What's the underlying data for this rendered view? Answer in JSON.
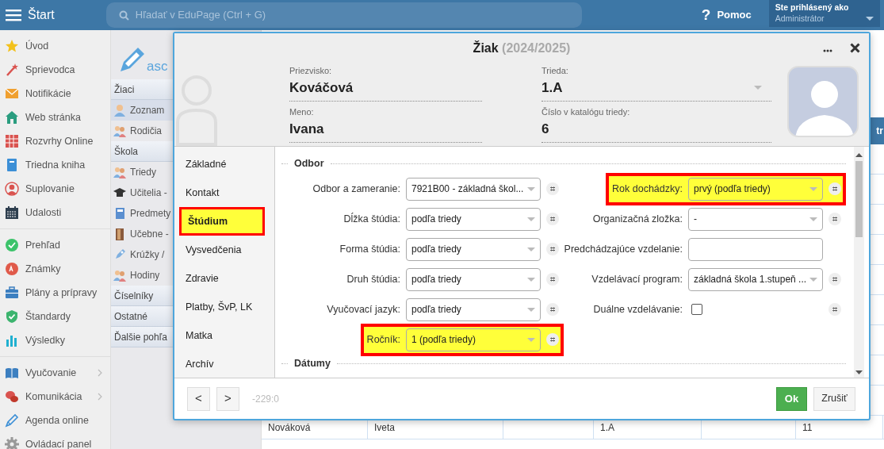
{
  "topbar": {
    "menu_label": "Štart",
    "search_placeholder": "Hľadať v EduPage (Ctrl + G)",
    "help_icon": "?",
    "help_label": "Pomoc",
    "login_caption": "Ste prihlásený ako",
    "user": "Administrátor"
  },
  "sidebar": {
    "groups": [
      {
        "items": [
          {
            "label": "Úvod",
            "has_submenu": false
          },
          {
            "label": "Sprievodca",
            "has_submenu": false
          },
          {
            "label": "Notifikácie",
            "has_submenu": false
          },
          {
            "label": "Web stránka",
            "has_submenu": false
          },
          {
            "label": "Rozvrhy Online",
            "has_submenu": false
          },
          {
            "label": "Triedna kniha",
            "has_submenu": false
          },
          {
            "label": "Suplovanie",
            "has_submenu": false
          },
          {
            "label": "Udalosti",
            "has_submenu": false
          }
        ]
      },
      {
        "items": [
          {
            "label": "Prehľad",
            "has_submenu": false
          },
          {
            "label": "Známky",
            "has_submenu": false
          },
          {
            "label": "Plány a prípravy",
            "has_submenu": false
          },
          {
            "label": "Štandardy",
            "has_submenu": false
          },
          {
            "label": "Výsledky",
            "has_submenu": false
          }
        ]
      },
      {
        "items": [
          {
            "label": "Vyučovanie",
            "has_submenu": true
          },
          {
            "label": "Komunikácia",
            "has_submenu": true
          },
          {
            "label": "Agenda online",
            "has_submenu": false
          },
          {
            "label": "Ovládací panel",
            "has_submenu": false
          }
        ]
      }
    ]
  },
  "subnav": {
    "logo_text": "asc",
    "sections": [
      {
        "title": "Žiaci",
        "items": [
          {
            "label": "Zoznam",
            "selected": true
          },
          {
            "label": "Rodičia",
            "selected": false
          }
        ]
      },
      {
        "title": "Škola",
        "items": [
          {
            "label": "Triedy",
            "selected": false
          },
          {
            "label": "Učitelia -",
            "selected": false
          },
          {
            "label": "Predmety",
            "selected": false
          },
          {
            "label": "Učebne -",
            "selected": false
          },
          {
            "label": "Krúžky /",
            "selected": false
          },
          {
            "label": "Hodiny",
            "selected": false
          }
        ]
      },
      {
        "title": "Číselníky"
      },
      {
        "title": "Ostatné"
      },
      {
        "title": "Ďalšie pohľa"
      }
    ]
  },
  "background_table": {
    "header_fragment": "tr",
    "rows": [
      {
        "cells": [
          "Nováková",
          "Iveta",
          "",
          "1.A",
          "",
          "11"
        ]
      }
    ]
  },
  "dialog": {
    "title": "Žiak",
    "subtitle": "(2024/2025)",
    "header_fields": [
      {
        "label": "Priezvisko:",
        "value": "Kováčová",
        "dropdown": false
      },
      {
        "label": "Trieda:",
        "value": "1.A",
        "dropdown": true
      },
      {
        "label": "Meno:",
        "value": "Ivana",
        "dropdown": false
      },
      {
        "label": "Číslo v katalógu triedy:",
        "value": "6",
        "dropdown": false
      }
    ],
    "tabs": [
      {
        "label": "Základné",
        "selected": false,
        "highlighted": false
      },
      {
        "label": "Kontakt",
        "selected": false,
        "highlighted": false
      },
      {
        "label": "Štúdium",
        "selected": true,
        "highlighted": true
      },
      {
        "label": "Vysvedčenia",
        "selected": false,
        "highlighted": false
      },
      {
        "label": "Zdravie",
        "selected": false,
        "highlighted": false
      },
      {
        "label": "Platby, ŠvP, LK",
        "selected": false,
        "highlighted": false
      },
      {
        "label": "Matka",
        "selected": false,
        "highlighted": false
      },
      {
        "label": "Archív",
        "selected": false,
        "highlighted": false
      }
    ],
    "sections": [
      {
        "title": "Odbor",
        "rows": [
          {
            "left": {
              "label": "Odbor a zameranie:",
              "kind": "select",
              "value": "7921B00 - základná škol...",
              "hash": "⌗",
              "highlighted": false
            },
            "right": {
              "label": "Rok dochádzky:",
              "kind": "select",
              "value": "prvý (podľa triedy)",
              "hash": "⌗",
              "highlighted": true
            }
          },
          {
            "left": {
              "label": "Dĺžka štúdia:",
              "kind": "select",
              "value": "podľa triedy",
              "hash": "⌗",
              "highlighted": false
            },
            "right": {
              "label": "Organizačná zložka:",
              "kind": "select",
              "value": "-",
              "hash": "⌗",
              "highlighted": false
            }
          },
          {
            "left": {
              "label": "Forma štúdia:",
              "kind": "select",
              "value": "podľa triedy",
              "hash": "⌗",
              "highlighted": false
            },
            "right": {
              "label": "Predchádzajúce vzdelanie:",
              "kind": "input",
              "highlighted": false
            }
          },
          {
            "left": {
              "label": "Druh štúdia:",
              "kind": "select",
              "value": "podľa triedy",
              "hash": "⌗",
              "highlighted": false
            },
            "right": {
              "label": "Vzdelávací program:",
              "kind": "select",
              "value": "základná škola 1.stupeň ...",
              "hash": "⌗",
              "highlighted": false
            }
          },
          {
            "left": {
              "label": "Vyučovací jazyk:",
              "kind": "select",
              "value": "podľa triedy",
              "hash": "⌗",
              "highlighted": false
            },
            "right": {
              "label": "Duálne vzdelávanie:",
              "kind": "checkbox",
              "checked": false,
              "hash": "⌗",
              "highlighted": false
            }
          },
          {
            "left": {
              "label": "Ročník:",
              "kind": "select",
              "value": "1 (podľa triedy)",
              "hash": "⌗",
              "highlighted": true
            }
          }
        ]
      },
      {
        "title": "Dátumy"
      }
    ],
    "footer": {
      "prev": "<",
      "next": ">",
      "position": "-229:0",
      "ok": "Ok",
      "cancel": "Zrušiť"
    }
  }
}
